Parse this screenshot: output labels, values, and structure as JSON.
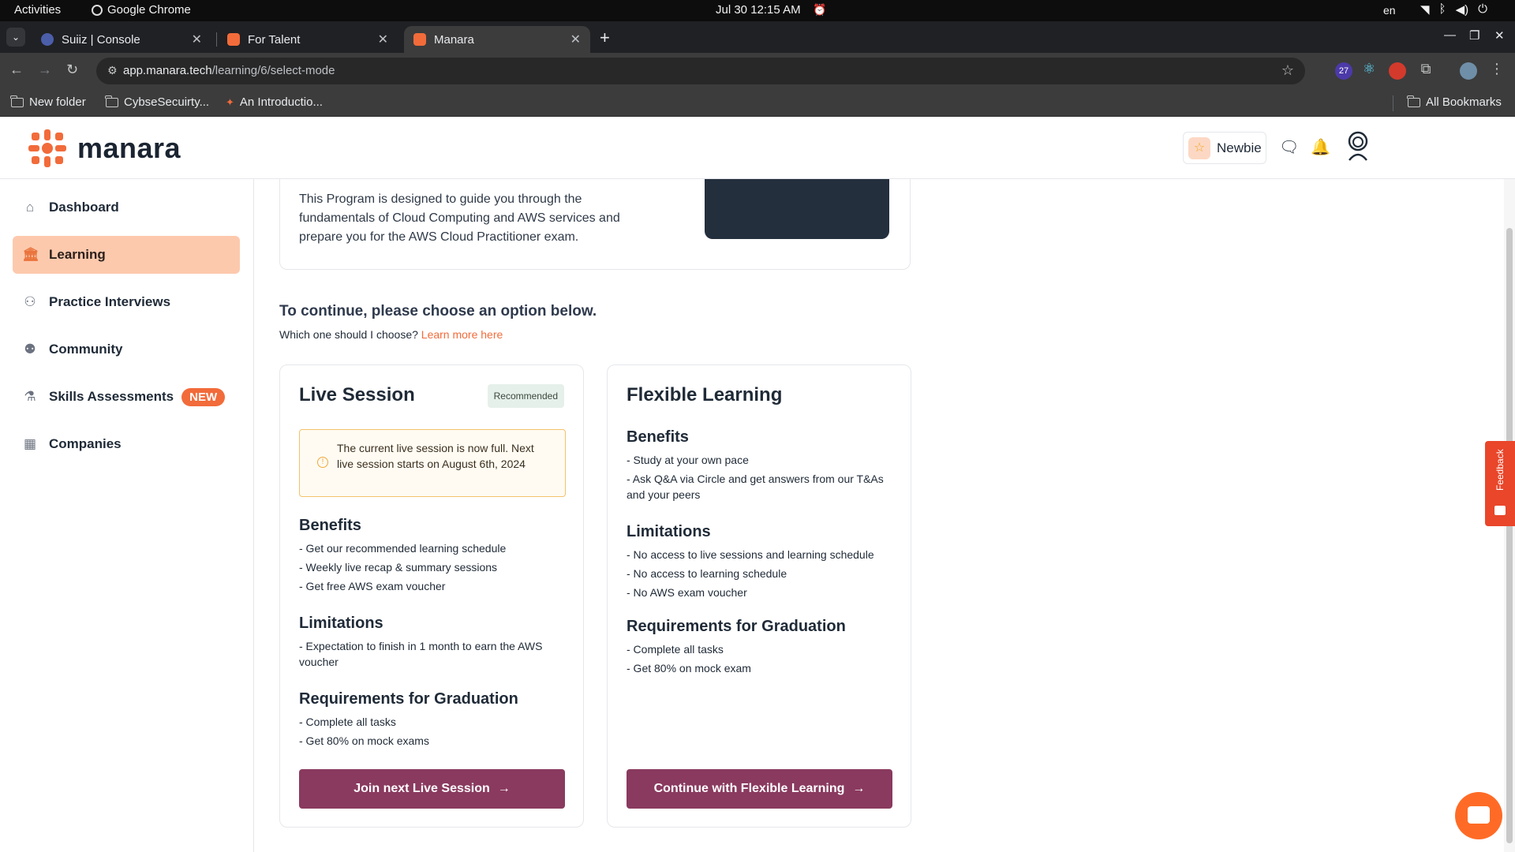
{
  "os": {
    "activities": "Activities",
    "app_name": "Google Chrome",
    "clock": "Jul 30  12:15 AM",
    "lang": "en"
  },
  "browser": {
    "tabs": [
      {
        "label": "Suiiz | Console"
      },
      {
        "label": "For Talent"
      },
      {
        "label": "Manara"
      }
    ],
    "url_host": "app.manara.tech",
    "url_path": "/learning/6/select-mode",
    "ext_badge_count": "27",
    "bookmarks": [
      {
        "label": "New folder"
      },
      {
        "label": "CybseSecuirty..."
      },
      {
        "label": "An Introductio..."
      }
    ],
    "all_bookmarks": "All Bookmarks"
  },
  "header": {
    "brand": "manara",
    "rank_label": "Newbie"
  },
  "sidebar": {
    "items": [
      {
        "label": "Dashboard"
      },
      {
        "label": "Learning"
      },
      {
        "label": "Practice Interviews"
      },
      {
        "label": "Community"
      },
      {
        "label": "Skills Assessments"
      },
      {
        "label": "Companies"
      }
    ],
    "new_badge": "NEW"
  },
  "program": {
    "description": "This Program is designed to guide you through the fundamentals of Cloud Computing and AWS services and prepare you for the AWS Cloud Practitioner exam."
  },
  "choose": {
    "title": "To continue, please choose an option below.",
    "sub": "Which one should I choose?",
    "learn_more": "Learn more here"
  },
  "live": {
    "title": "Live Session",
    "badge": "Recommended",
    "notice": "The current live session is now full. Next live session starts on August 6th, 2024",
    "benefits_title": "Benefits",
    "benefits": [
      "- Get our recommended learning schedule",
      "- Weekly live recap & summary sessions",
      "- Get free AWS exam voucher"
    ],
    "limitations_title": "Limitations",
    "limitations": [
      "- Expectation to finish in 1 month to earn the AWS voucher"
    ],
    "requirements_title": "Requirements for Graduation",
    "requirements": [
      "- Complete all tasks",
      "- Get 80% on mock exams"
    ],
    "cta": "Join next Live Session"
  },
  "flexible": {
    "title": "Flexible Learning",
    "benefits_title": "Benefits",
    "benefits": [
      "- Study at your own pace",
      "- Ask Q&A via Circle and get answers from our T&As and your peers"
    ],
    "limitations_title": "Limitations",
    "limitations": [
      "- No access to live sessions and learning schedule",
      "- No access to learning schedule",
      "- No AWS exam voucher"
    ],
    "requirements_title": "Requirements for Graduation",
    "requirements": [
      "- Complete all tasks",
      "- Get 80% on mock exam"
    ],
    "cta": "Continue with Flexible Learning"
  },
  "feedback_label": "Feedback",
  "colors": {
    "brand_orange": "#f26b3a",
    "cta_plum": "#8a3a5f",
    "active_nav": "#fdc9ad"
  }
}
